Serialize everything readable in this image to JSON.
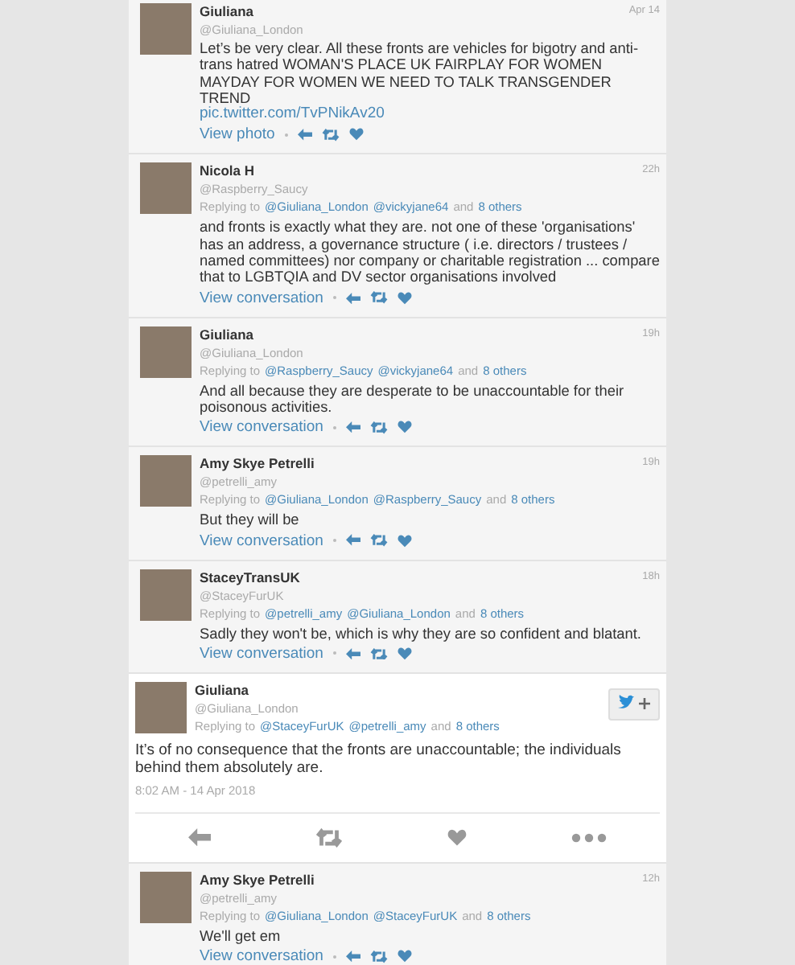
{
  "tweets": [
    {
      "kind": "reply",
      "name": "Giuliana",
      "handle": "@Giuliana_London",
      "time": "Apr 14",
      "text": "Let’s be very clear. All these fronts are vehicles for bigotry and anti-trans hatred WOMAN'S PLACE UK FAIRPLAY FOR WOMEN MAYDAY FOR WOMEN WE NEED TO TALK TRANSGENDER TREND",
      "link": "pic.twitter.com/TvPNikAv20",
      "view": "View photo"
    },
    {
      "kind": "reply",
      "name": "Nicola H",
      "handle": "@Raspberry_Saucy",
      "time": "22h",
      "replying": {
        "prefix": "Replying to",
        "mentions": [
          "@Giuliana_London",
          "@vickyjane64"
        ],
        "and": "and",
        "others": "8 others"
      },
      "text": "and fronts is exactly what they are. not one of these 'organisations' has an address, a governance structure ( i.e. directors / trustees / named committees) nor company or charitable registration ... compare that to LGBTQIA and DV sector organisations involved",
      "view": "View conversation"
    },
    {
      "kind": "reply",
      "name": "Giuliana",
      "handle": "@Giuliana_London",
      "time": "19h",
      "replying": {
        "prefix": "Replying to",
        "mentions": [
          "@Raspberry_Saucy",
          "@vickyjane64"
        ],
        "and": "and",
        "others": "8 others"
      },
      "text": "And all because they are desperate to be unaccountable for their poisonous activities.",
      "view": "View conversation"
    },
    {
      "kind": "reply",
      "name": "Amy Skye Petrelli",
      "handle": "@petrelli_amy",
      "time": "19h",
      "replying": {
        "prefix": "Replying to",
        "mentions": [
          "@Giuliana_London",
          "@Raspberry_Saucy"
        ],
        "and": "and",
        "others": "8 others"
      },
      "text": "But they will be",
      "view": "View conversation"
    },
    {
      "kind": "reply",
      "name": "StaceyTransUK",
      "handle": "@StaceyFurUK",
      "time": "18h",
      "replying": {
        "prefix": "Replying to",
        "mentions": [
          "@petrelli_amy",
          "@Giuliana_London"
        ],
        "and": "and",
        "others": "8 others"
      },
      "text": "Sadly they won't be, which is why they are so confident and blatant.",
      "view": "View conversation"
    },
    {
      "kind": "focused",
      "name": "Giuliana",
      "handle": "@Giuliana_London",
      "replying": {
        "prefix": "Replying to",
        "mentions": [
          "@StaceyFurUK",
          "@petrelli_amy"
        ],
        "and": "and",
        "others": "8 others"
      },
      "text": "It’s of no consequence that the fronts are unaccountable; the individuals behind them absolutely are.",
      "timestamp": "8:02 AM - 14 Apr 2018"
    },
    {
      "kind": "reply",
      "name": "Amy Skye Petrelli",
      "handle": "@petrelli_amy",
      "time": "12h",
      "replying": {
        "prefix": "Replying to",
        "mentions": [
          "@Giuliana_London",
          "@StaceyFurUK"
        ],
        "and": "and",
        "others": "8 others"
      },
      "text": "We'll get em",
      "view": "View conversation"
    }
  ]
}
